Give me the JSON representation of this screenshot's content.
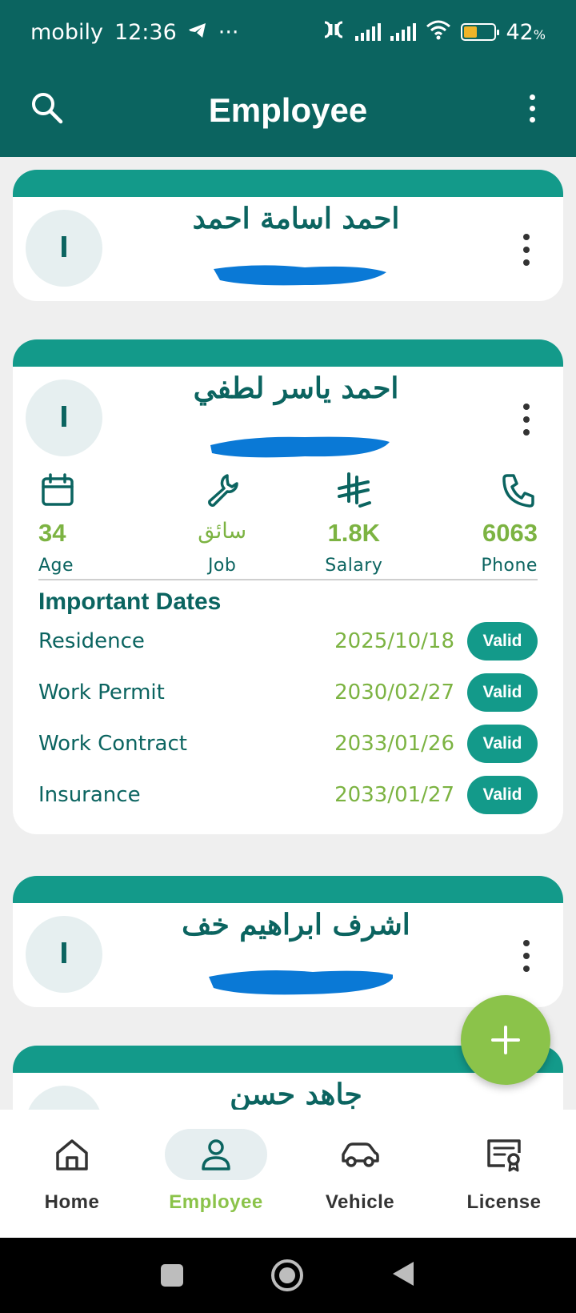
{
  "status": {
    "carrier": "mobily",
    "time": "12:36",
    "ellipsis": "···",
    "battery": "42",
    "battery_unit": "%",
    "battery_level": 0.42
  },
  "appbar": {
    "title": "Employee"
  },
  "employees": [
    {
      "initial": "ا",
      "name": "احمد اسامة احمد"
    },
    {
      "initial": "ا",
      "name": "احمد ياسر لطفي",
      "stats": [
        {
          "value": "34",
          "label": "Age",
          "icon": "calendar-icon"
        },
        {
          "value": "سائق",
          "label": "Job",
          "icon": "wrench-icon"
        },
        {
          "value": "1.8K",
          "label": "Salary",
          "icon": "riyal-icon"
        },
        {
          "value": "6063",
          "label": "Phone",
          "icon": "phone-icon"
        }
      ],
      "important_dates_title": "Important Dates",
      "dates": [
        {
          "label": "Residence",
          "date": "2025/10/18",
          "status": "Valid"
        },
        {
          "label": "Work Permit",
          "date": "2030/02/27",
          "status": "Valid"
        },
        {
          "label": "Work Contract",
          "date": "2033/01/26",
          "status": "Valid"
        },
        {
          "label": "Insurance",
          "date": "2033/01/27",
          "status": "Valid"
        }
      ]
    },
    {
      "initial": "ا",
      "name": "اشرف ابراهيم خف"
    },
    {
      "initial": "",
      "name": "جاهد حسن"
    }
  ],
  "nav": [
    {
      "label": "Home",
      "icon": "home-icon"
    },
    {
      "label": "Employee",
      "icon": "person-icon",
      "active": true
    },
    {
      "label": "Vehicle",
      "icon": "car-icon"
    },
    {
      "label": "License",
      "icon": "certificate-icon"
    }
  ],
  "colors": {
    "primary": "#0b6460",
    "band": "#139a8a",
    "accent": "#8bc34a",
    "date_green": "#7cb342"
  }
}
